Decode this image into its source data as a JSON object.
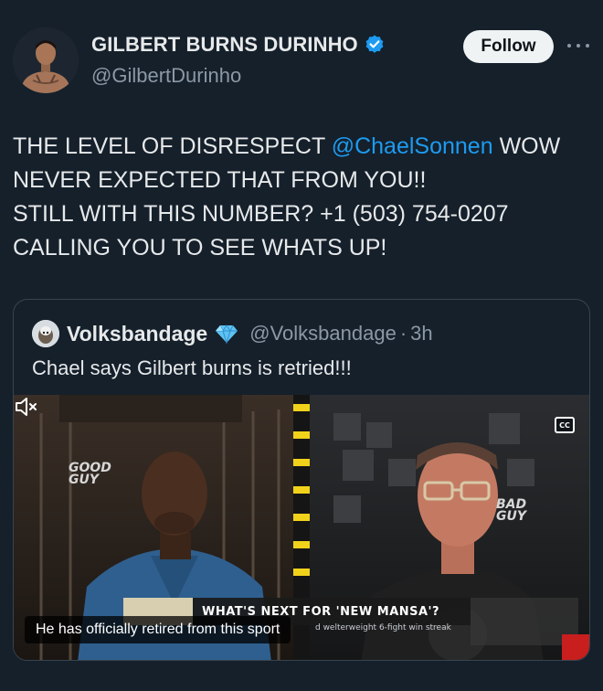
{
  "author": {
    "display_name": "GILBERT BURNS DURINHO",
    "handle": "@GilbertDurinho",
    "verified_icon": "verified-badge-icon",
    "follow_label": "Follow"
  },
  "tweet": {
    "text_prefix": "THE LEVEL OF DISRESPECT ",
    "mention": "@ChaelSonnen",
    "text_suffix": " WOW\nNEVER EXPECTED THAT FROM YOU!!\nSTILL WITH THIS NUMBER? +1 (503) 754-0207\nCALLING YOU TO SEE WHATS UP!"
  },
  "quote": {
    "display_name": "Volksbandage",
    "badge_icon": "diamond-badge-icon",
    "handle": "@Volksbandage",
    "separator": "·",
    "time": "3h",
    "text": "Chael says Gilbert burns is retried!!!",
    "video": {
      "caption": "He has officially retired from this sport",
      "cc_label": "CC",
      "lower_third": "WHAT'S NEXT FOR 'NEW MANSA'?",
      "lower_third_sub": "d welterweight 6-fight win streak",
      "bug_left": "GOOD\nGUY",
      "bug_right": "BAD\nGUY",
      "mute_icon": "muted-speaker-icon"
    }
  },
  "colors": {
    "background": "#15202b",
    "text": "#e7e9ea",
    "secondary": "#8b98a5",
    "link": "#1d9bf0",
    "border": "#38444d",
    "follow_bg": "#eff3f4"
  }
}
